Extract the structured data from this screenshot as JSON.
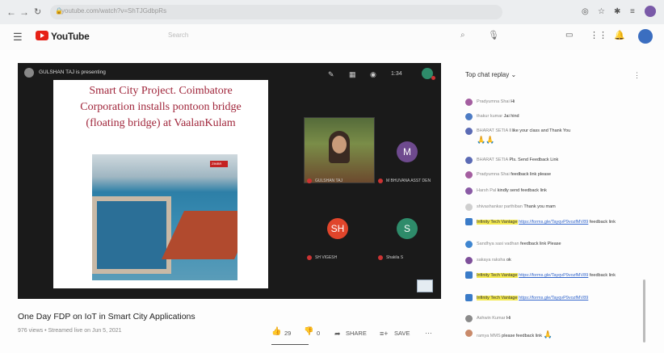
{
  "browser": {
    "url": "youtube.com/watch?v=ShTJGdbpRs"
  },
  "header": {
    "logo_text": "YouTube",
    "search_placeholder": "Search"
  },
  "player": {
    "presenting_text": "GULSHAN TAJ is presenting",
    "time_text": "1:34",
    "slide_title_lines": [
      "Smart City Project. Coimbatore",
      "Corporation installs pontoon bridge",
      "(floating bridge) at VaalanKulam"
    ],
    "photo_badge": "ZIMBR",
    "tiles": [
      {
        "name": "GULSHAN TAJ",
        "initials": ""
      },
      {
        "name": "M BHUVANA ASST DEN",
        "initials": "M",
        "color": "#6e4a8e"
      },
      {
        "name": "SH VIGESH",
        "initials": "SH",
        "color": "#e0452b"
      },
      {
        "name": "Shakila S",
        "initials": "S",
        "color": "#2e8b6a"
      }
    ]
  },
  "video": {
    "title": "One Day FDP on IoT in Smart City Applications",
    "meta": "976 views • Streamed live on Jun 5, 2021",
    "likes": "29",
    "dislikes": "0",
    "share_label": "SHARE",
    "save_label": "SAVE"
  },
  "chat": {
    "header": "Top chat replay",
    "messages": [
      {
        "author": "Pradyumna Shai",
        "text": "Hi",
        "color": "#a45ea0"
      },
      {
        "author": "thakur kumar",
        "text": "Jai hind",
        "color": "#4d7cc4"
      },
      {
        "author": "BHARAT SETIA",
        "text": "I like your class and Thank You",
        "color": "#5b6bb5",
        "emoji": "🙏🙏"
      },
      {
        "author": "BHARAT SETIA",
        "text": "Pls. Send Feedback Link",
        "color": "#5b6bb5"
      },
      {
        "author": "Pradyumna Shai",
        "text": "feedback link please",
        "color": "#a45ea0"
      },
      {
        "author": "Harsh Pal",
        "text": "kindly send feedback link",
        "color": "#8a5aa5"
      },
      {
        "author": "shivashankar parthiban",
        "text": "Thank you mam",
        "color": "#cfcfcf"
      },
      {
        "author": "Infinity Tech Vantage",
        "link": "https://forms.gle/TayqvP9vozfMV89",
        "text": "feedback link",
        "color": "#3a7bc8",
        "highlight": true
      },
      {
        "author": "Sandhya sasi vadhan",
        "text": "feedback link Please",
        "color": "#3f86d0"
      },
      {
        "author": "sakaya raksha",
        "text": "ok",
        "color": "#7e4f9a"
      },
      {
        "author": "Infinity Tech Vantage",
        "link": "https://forms.gle/TayqvP9vozfMV89",
        "text": "feedback link",
        "color": "#3a7bc8",
        "highlight": true
      },
      {
        "author": "Infinity Tech Vantage",
        "link": "https://forms.gle/TayqvP9vozfMV89",
        "text": "",
        "color": "#3a7bc8",
        "highlight": true
      },
      {
        "author": "Ashwin Kumar",
        "text": "Hi",
        "color": "#8a8a8a"
      },
      {
        "author": "ramya MMS",
        "text": "please feedback link",
        "color": "#c98a6a",
        "emoji": "🙏"
      }
    ]
  },
  "colors": {
    "yt_red": "#e62117",
    "highlight": "#f3e94f"
  }
}
